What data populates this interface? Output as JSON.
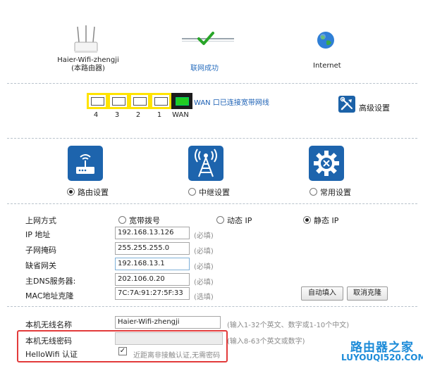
{
  "status": {
    "router_name": "Haier-Wifi-zhengji",
    "router_sub": "(本路由器)",
    "link_label": "联网成功",
    "internet_label": "Internet"
  },
  "ports": {
    "labels": [
      "4",
      "3",
      "2",
      "1",
      "WAN"
    ],
    "wan_status": "WAN 口已连接宽带网线"
  },
  "advanced": {
    "label": "高级设置"
  },
  "modes": {
    "router": "路由设置",
    "repeater": "中继设置",
    "common": "常用设置",
    "selected": "路由设置"
  },
  "connection": {
    "label": "上网方式",
    "options": [
      "宽带拨号",
      "动态 IP",
      "静态 IP"
    ],
    "selected": "静态 IP"
  },
  "form": {
    "ip": {
      "label": "IP 地址",
      "value": "192.168.13.126",
      "hint": "(必填)"
    },
    "mask": {
      "label": "子网掩码",
      "value": "255.255.255.0",
      "hint": "(必填)"
    },
    "gateway": {
      "label": "缺省网关",
      "value": "192.168.13.1",
      "hint": "(必填)"
    },
    "dns": {
      "label": "主DNS服务器:",
      "value": "202.106.0.20",
      "hint": "(必填)"
    },
    "mac": {
      "label": "MAC地址克隆",
      "value": "7C:7A:91:27:5F:33",
      "hint": "(选填)",
      "auto_btn": "自动填入",
      "cancel_btn": "取消克隆"
    }
  },
  "wifi": {
    "name_label": "本机无线名称",
    "name_value": "Haier-Wifi-zhengji",
    "name_hint": "(输入1-32个英文、数字或1-10个中文)",
    "pwd_label": "本机无线密码",
    "pwd_value": "",
    "pwd_hint": "(输入8-63个英文或数字)",
    "hello_label": "HelloWifi 认证",
    "hello_checked": true,
    "hello_mark": "✓",
    "hello_text": "近距离非接触认证,无需密码"
  },
  "watermark": {
    "line1": "路由器之家",
    "line2": "LUYOUQI520.COM"
  }
}
